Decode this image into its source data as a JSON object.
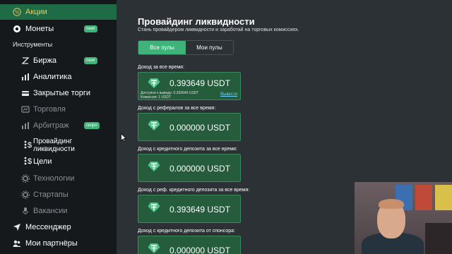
{
  "sidebar": {
    "items": [
      {
        "label": "Акции",
        "icon": "percent-icon",
        "active": true
      },
      {
        "label": "Монеты",
        "icon": "coins-icon",
        "badge": "new!"
      },
      {
        "label": "Биржа",
        "icon": "exchange-icon",
        "badge": "new!"
      },
      {
        "label": "Аналитика",
        "icon": "analytics-icon"
      },
      {
        "label": "Закрытые торги",
        "icon": "closed-trades-icon"
      },
      {
        "label": "Торговля",
        "icon": "trading-icon"
      },
      {
        "label": "Арбитраж",
        "icon": "arbitrage-icon",
        "badge": "скоро"
      },
      {
        "label": "Провайдинг\nликвидности",
        "icon": "liquidity-icon"
      },
      {
        "label": "Цели",
        "icon": "goals-icon"
      },
      {
        "label": "Технологии",
        "icon": "technologies-icon"
      },
      {
        "label": "Стартапы",
        "icon": "startups-icon"
      },
      {
        "label": "Вакансии",
        "icon": "vacancies-icon"
      },
      {
        "label": "Мессенджер",
        "icon": "messenger-icon"
      },
      {
        "label": "Мои партнёры",
        "icon": "partners-icon"
      }
    ],
    "section_title": "Инструменты"
  },
  "main": {
    "title": "Провайдинг ликвидности",
    "subtitle": "Стань провайдером ликвидности и заработай на торговых комиссиях.",
    "tabs": [
      {
        "label": "Все пулы",
        "active": true
      },
      {
        "label": "Мои пулы",
        "active": false
      }
    ],
    "cards": [
      {
        "label": "Доход за все время:",
        "amount": "0.393649 USDT",
        "available": "Доступно к выводу: 0.393649 USDT",
        "commission": "Комиссия: 1 USDT",
        "withdraw": "Вывести"
      },
      {
        "label": "Доход с рефералов за все время:",
        "amount": "0.000000 USDT"
      },
      {
        "label": "Доход с кредитного депозита за все время:",
        "amount": "0.000000 USDT"
      },
      {
        "label": "Доход с реф. кредитного депозита за все время:",
        "amount": "0.393649 USDT"
      },
      {
        "label": "Доход с кредитного депозита от спонсора:",
        "amount": "0.000000 USDT"
      }
    ]
  },
  "colors": {
    "sidebar_bg": "#16191c",
    "main_bg": "#2c3136",
    "accent": "#3fb37a",
    "card_bg": "#245c3c",
    "active_item": "#1f6b45",
    "link": "#6fd3ff"
  }
}
